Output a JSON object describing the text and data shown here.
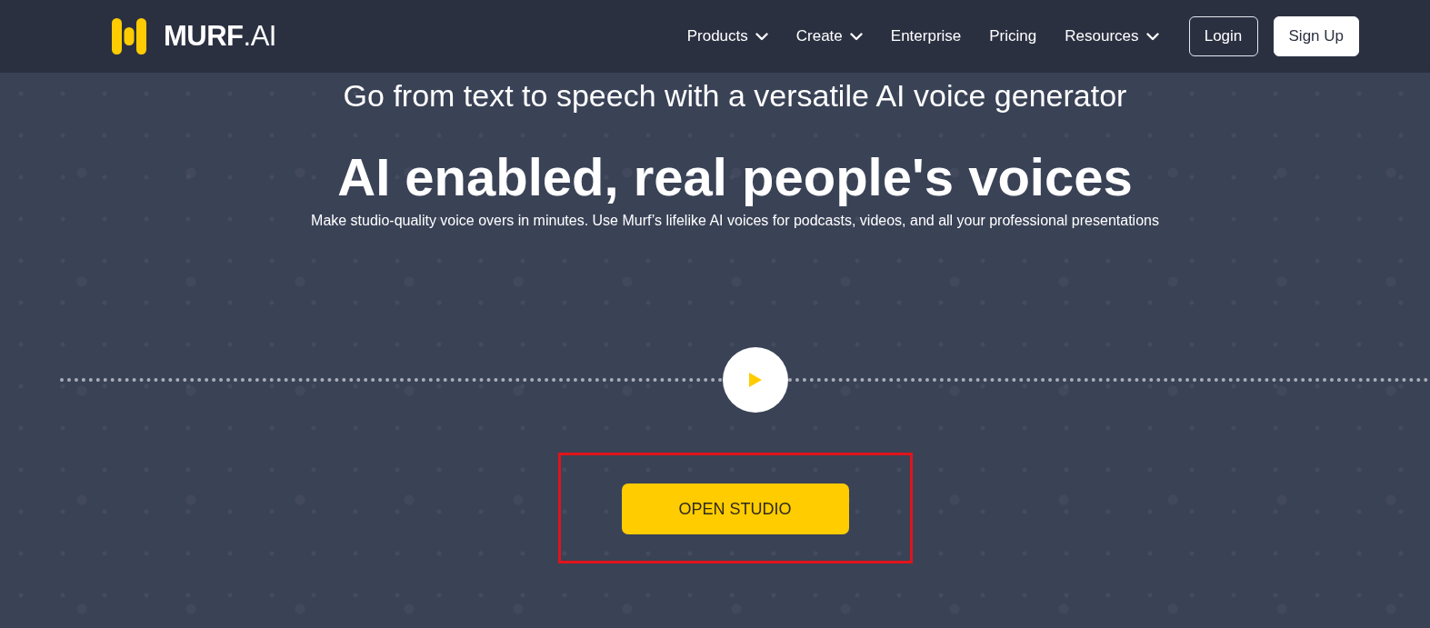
{
  "nav": {
    "logo": {
      "text": "**MURF**.AI"
    },
    "links": [
      {
        "label": "Products",
        "dropdown": true
      },
      {
        "label": "Create",
        "dropdown": true
      },
      {
        "label": "Enterprise",
        "dropdown": false
      },
      {
        "label": "Pricing",
        "dropdown": false
      },
      {
        "label": "Resources",
        "dropdown": true
      }
    ],
    "buttons": [
      {
        "label": "Login",
        "kind": "outline"
      },
      {
        "label": "Sign Up",
        "kind": "solid"
      }
    ]
  },
  "hero": {
    "subtitle": "Go from text to speech with a versatile AI voice generator",
    "headline": "AI enabled, real people's voices",
    "description": "Make studio-quality voice overs in minutes. Use Murf’s lifelike AI voices for podcasts, videos, and all your professional presentations",
    "cta": {
      "label": "OPEN STUDIO",
      "highlighted": true
    }
  }
}
